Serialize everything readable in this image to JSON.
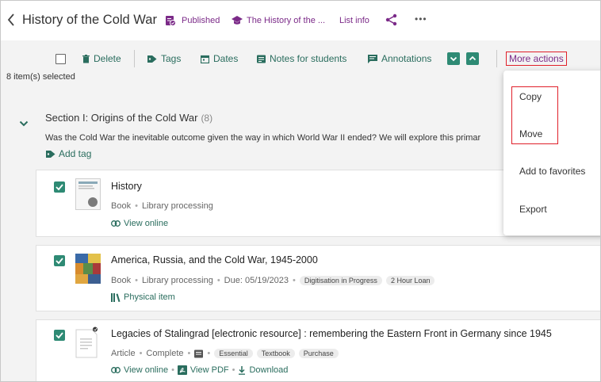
{
  "header": {
    "title": "History of the Cold War",
    "status": "Published",
    "course": "The History of the ...",
    "list_info": "List info"
  },
  "toolbar": {
    "delete": "Delete",
    "tags": "Tags",
    "dates": "Dates",
    "notes": "Notes for students",
    "annotations": "Annotations",
    "more_actions": "More actions",
    "selected": "8 item(s) selected"
  },
  "section": {
    "title": "Section I: Origins of the Cold War",
    "count": "(8)",
    "description": "Was the Cold War the inevitable outcome given the way in which World War II ended? We will explore this primar",
    "add_tag": "Add tag"
  },
  "items": [
    {
      "title": "History",
      "type": "Book",
      "status": "Library processing",
      "link": "View online"
    },
    {
      "title": "America, Russia, and the Cold War, 1945-2000",
      "type": "Book",
      "status": "Library processing",
      "due": "Due: 05/19/2023",
      "chips": [
        "Digitisation in Progress",
        "2 Hour Loan"
      ],
      "link": "Physical item"
    },
    {
      "title": "Legacies of Stalingrad [electronic resource] : remembering the Eastern Front in Germany since 1945",
      "type": "Article",
      "status": "Complete",
      "chips": [
        "Essential",
        "Textbook",
        "Purchase"
      ],
      "link_online": "View online",
      "link_pdf": "View PDF",
      "link_download": "Download"
    }
  ],
  "dropdown": {
    "copy": "Copy",
    "move": "Move",
    "favorites": "Add to favorites",
    "export": "Export"
  },
  "colors": {
    "accent_green": "#2e8a74",
    "purple": "#7b2a88",
    "highlight_red": "#e0202a"
  }
}
